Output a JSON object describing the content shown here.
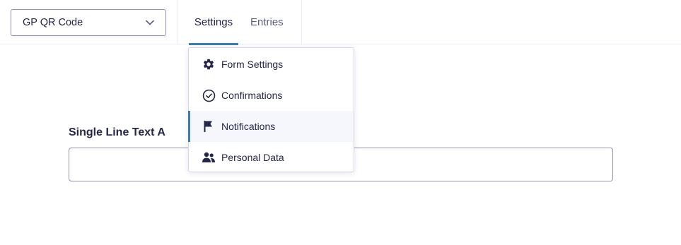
{
  "form_selector": {
    "value": "GP QR Code",
    "icon": "chevron-down-icon"
  },
  "tabs": [
    {
      "label": "Settings",
      "active": true
    },
    {
      "label": "Entries",
      "active": false
    }
  ],
  "settings_menu": {
    "items": [
      {
        "label": "Form Settings",
        "icon": "gear-icon",
        "active": false
      },
      {
        "label": "Confirmations",
        "icon": "check-circle-icon",
        "active": false
      },
      {
        "label": "Notifications",
        "icon": "flag-icon",
        "active": true
      },
      {
        "label": "Personal Data",
        "icon": "users-icon",
        "active": false
      }
    ]
  },
  "form": {
    "field_label": "Single Line Text A",
    "field_value": ""
  },
  "colors": {
    "accent": "#3e7da6",
    "text": "#242748",
    "border": "#9092b2"
  }
}
